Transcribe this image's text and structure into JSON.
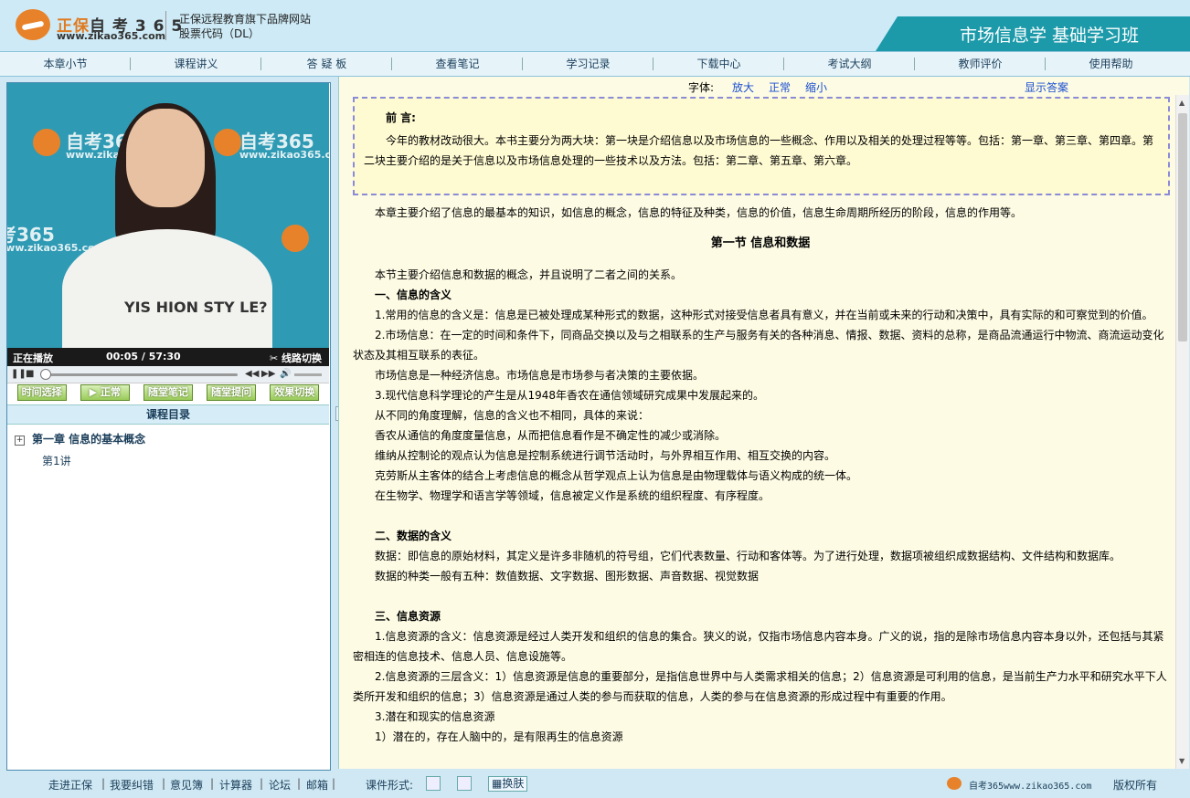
{
  "header": {
    "logo_brand": "正保",
    "logo_name": "自 考 3 6 5",
    "logo_url": "www.zikao365.com",
    "slogan_line1": "正保远程教育旗下品牌网站",
    "slogan_line2": "股票代码（DL）",
    "course_title": "市场信息学 基础学习班"
  },
  "nav": [
    "本章小节",
    "课程讲义",
    "答 疑 板",
    "查看笔记",
    "学习记录",
    "下载中心",
    "考试大纲",
    "教师评价",
    "使用帮助"
  ],
  "video": {
    "bg_brand": "自考365",
    "bg_url": "www.zikao365.com",
    "shirt_text": "YIS HION STY LE?",
    "status": "正在播放",
    "time": "00:05 / 57:30",
    "line_switch": "线路切换"
  },
  "player_buttons": [
    "时间选择",
    "▶ 正常",
    "随堂笔记",
    "随堂提问",
    "效果切换"
  ],
  "toc": {
    "title": "课程目录",
    "chapter": "第一章  信息的基本概念",
    "lesson": "第1讲"
  },
  "font_bar": {
    "label": "字体:",
    "bigger": "放大",
    "normal": "正常",
    "smaller": "缩小",
    "show_answer": "显示答案"
  },
  "preface": {
    "title": "前  言:",
    "text": "今年的教材改动很大。本书主要分为两大块：第一块是介绍信息以及市场信息的一些概念、作用以及相关的处理过程等等。包括：第一章、第三章、第四章。第二块主要介绍的是关于信息以及市场信息处理的一些技术以及方法。包括：第二章、第五章、第六章。"
  },
  "content": {
    "intro": "本章主要介绍了信息的最基本的知识，如信息的概念，信息的特征及种类，信息的价值，信息生命周期所经历的阶段，信息的作用等。",
    "section_title": "第一节  信息和数据",
    "section_intro": "本节主要介绍信息和数据的概念，并且说明了二者之间的关系。",
    "h1": "一、信息的含义",
    "p1": "1.常用的信息的含义是：信息是已被处理成某种形式的数据，这种形式对接受信息者具有意义，并在当前或未来的行动和决策中，具有实际的和可察觉到的价值。",
    "p2": "2.市场信息：在一定的时间和条件下，同商品交换以及与之相联系的生产与服务有关的各种消息、情报、数据、资料的总称，是商品流通运行中物流、商流运动变化状态及其相互联系的表征。",
    "p3": "市场信息是一种经济信息。市场信息是市场参与者决策的主要依据。",
    "p4": "3.现代信息科学理论的产生是从1948年香农在通信领域研究成果中发展起来的。",
    "p5": "从不同的角度理解，信息的含义也不相同，具体的来说：",
    "p6": "香农从通信的角度度量信息，从而把信息看作是不确定性的减少或消除。",
    "p7": "维纳从控制论的观点认为信息是控制系统进行调节活动时，与外界相互作用、相互交换的内容。",
    "p8": "克劳斯从主客体的结合上考虑信息的概念从哲学观点上认为信息是由物理载体与语义构成的统一体。",
    "p9": "在生物学、物理学和语言学等领域，信息被定义作是系统的组织程度、有序程度。",
    "h2": "二、数据的含义",
    "p10": "数据：即信息的原始材料，其定义是许多非随机的符号组，它们代表数量、行动和客体等。为了进行处理，数据项被组织成数据结构、文件结构和数据库。",
    "p11": "数据的种类一般有五种：数值数据、文字数据、图形数据、声音数据、视觉数据",
    "h3": "三、信息资源",
    "p12": "1.信息资源的含义：信息资源是经过人类开发和组织的信息的集合。狭义的说，仅指市场信息内容本身。广义的说，指的是除市场信息内容本身以外，还包括与其紧密相连的信息技术、信息人员、信息设施等。",
    "p13": "2.信息资源的三层含义：1）信息资源是信息的重要部分，是指信息世界中与人类需求相关的信息；2）信息资源是可利用的信息，是当前生产力水平和研究水平下人类所开发和组织的信息；3）信息资源是通过人类的参与而获取的信息，人类的参与在信息资源的形成过程中有重要的作用。",
    "p14": "3.潜在和现实的信息资源",
    "p15": "1）潜在的，存在人脑中的，是有限再生的信息资源"
  },
  "footer": {
    "links": [
      "走进正保",
      "我要纠错",
      "意见簿",
      "计算器",
      "论坛",
      "邮箱"
    ],
    "format_label": "课件形式:",
    "skin": "换肤",
    "site": "自考365www.zikao365.com",
    "copyright": "版权所有"
  }
}
